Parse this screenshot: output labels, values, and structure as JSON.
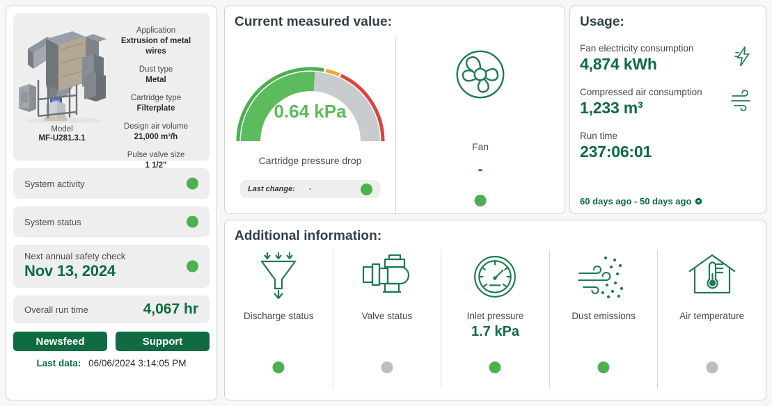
{
  "machine": {
    "image_alt": "industrial-dust-collector",
    "model_label": "Model",
    "model_value": "MF-U281.3.1",
    "specs": [
      {
        "label": "Application",
        "value": "Extrusion of metal wires"
      },
      {
        "label": "Dust type",
        "value": "Metal"
      },
      {
        "label": "Cartridge type",
        "value": "Filterplate"
      },
      {
        "label": "Design air volume",
        "value": "21,000 m³/h"
      },
      {
        "label": "Pulse valve size",
        "value": "1 1/2\""
      }
    ]
  },
  "status_rows": [
    {
      "label": "System activity",
      "state": "green"
    },
    {
      "label": "System status",
      "state": "green"
    }
  ],
  "safety_check": {
    "label": "Next annual safety check",
    "value": "Nov 13, 2024",
    "state": "green"
  },
  "overall_runtime": {
    "label": "Overall run time",
    "value": "4,067 hr"
  },
  "buttons": {
    "newsfeed": "Newsfeed",
    "support": "Support"
  },
  "last_data": {
    "label": "Last data:",
    "value": "06/06/2024 3:14:05 PM"
  },
  "measured": {
    "title": "Current measured value:",
    "cartridge_icon": "filter-cartridge-icon",
    "gauge": {
      "value_text": "0.64 kPa",
      "caption": "Cartridge pressure drop",
      "value": 0.64,
      "min": 0,
      "max": 3,
      "fill_fraction": 0.52,
      "green_color": "#5cbb5c",
      "track_color": "#c9ccce",
      "ring_green": "#4cb050",
      "ring_orange": "#f0a830",
      "ring_red": "#d9453c",
      "ring_green_end": 0.56,
      "ring_orange_end": 0.63
    },
    "last_change": {
      "label": "Last change:",
      "value": "-",
      "state": "green"
    },
    "fan": {
      "icon": "fan-icon",
      "label": "Fan",
      "value": "-",
      "state": "green"
    }
  },
  "usage": {
    "title": "Usage:",
    "items": [
      {
        "label": "Fan electricity consumption",
        "value": "4,874 kWh",
        "icon": "lightning-bolt-icon"
      },
      {
        "label": "Compressed air consumption",
        "value": "1,233 m³",
        "icon": "wind-icon"
      },
      {
        "label": "Run time",
        "value": "237:06:01",
        "icon": ""
      }
    ],
    "footer": "60 days ago - 50 days ago"
  },
  "additional_information": {
    "title": "Additional information:",
    "items": [
      {
        "label": "Discharge status",
        "value": "",
        "icon": "funnel-discharge-icon",
        "state": "green"
      },
      {
        "label": "Valve status",
        "value": "",
        "icon": "valve-icon",
        "state": "grey"
      },
      {
        "label": "Inlet pressure",
        "value": "1.7 kPa",
        "icon": "pressure-gauge-icon",
        "state": "green"
      },
      {
        "label": "Dust emissions",
        "value": "",
        "icon": "dust-wind-icon",
        "state": "green"
      },
      {
        "label": "Air temperature",
        "value": "",
        "icon": "indoor-thermometer-icon",
        "state": "grey"
      }
    ]
  },
  "colors": {
    "brand_green": "#0c6b42",
    "status_green": "#4cb050",
    "status_grey": "#bdbdbd",
    "warning_orange": "#f0a830",
    "danger_red": "#d9453c"
  }
}
